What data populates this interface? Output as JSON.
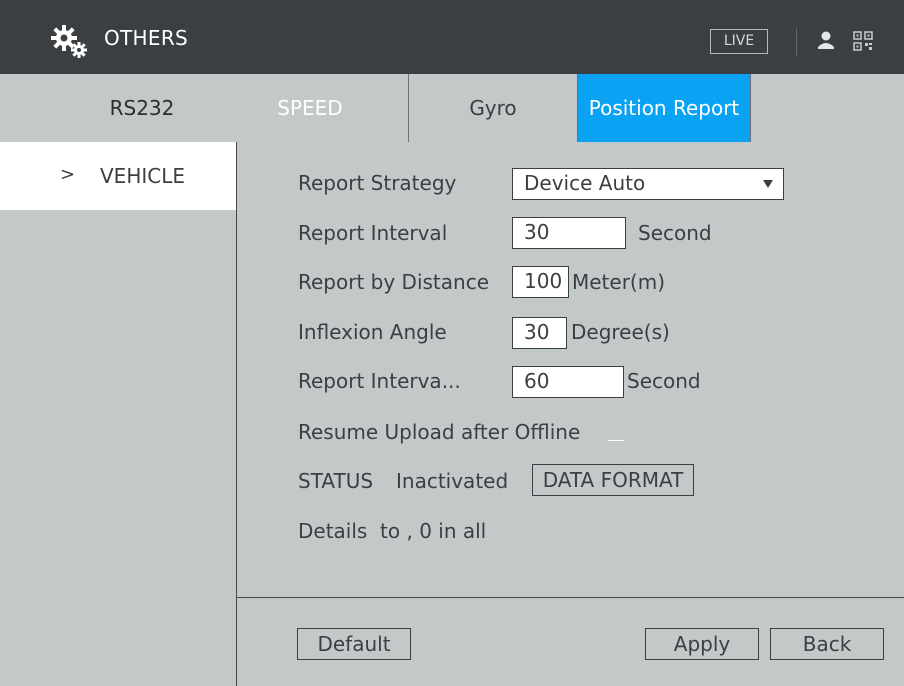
{
  "header": {
    "title": "OTHERS",
    "live_label": "LIVE",
    "icons": [
      "gear-icon",
      "user-icon",
      "qr-icon"
    ]
  },
  "tabs": [
    {
      "label": "RS232",
      "active": false
    },
    {
      "label": "SPEED",
      "active": false
    },
    {
      "label": "Gyro",
      "active": false
    },
    {
      "label": "Position Report",
      "active": true
    }
  ],
  "sidebar": {
    "items": [
      {
        "chevron": ">",
        "label": "VEHICLE",
        "selected": true
      }
    ]
  },
  "form": {
    "report_strategy": {
      "label": "Report Strategy",
      "value": "Device Auto"
    },
    "report_interval": {
      "label": "Report Interval",
      "value": "30",
      "unit": "Second"
    },
    "report_distance": {
      "label": "Report by Distance",
      "value": "100",
      "unit": "Meter(m)"
    },
    "inflexion_angle": {
      "label": "Inflexion Angle",
      "value": "30",
      "unit": "Degree(s)"
    },
    "report_interval_2": {
      "label": "Report Interva...",
      "value": "60",
      "unit": "Second"
    },
    "resume_upload": {
      "label": "Resume Upload after Offline"
    },
    "status": {
      "label": "STATUS",
      "value": "Inactivated",
      "button": "DATA FORMAT"
    },
    "details": {
      "text": "Details  to , 0 in all"
    }
  },
  "footer": {
    "default_label": "Default",
    "apply_label": "Apply",
    "back_label": "Back"
  },
  "colors": {
    "header_bg": "#3c3f42",
    "panel_bg": "#c3c8c9",
    "accent": "#0aa3f3",
    "text": "#3c3f42"
  }
}
